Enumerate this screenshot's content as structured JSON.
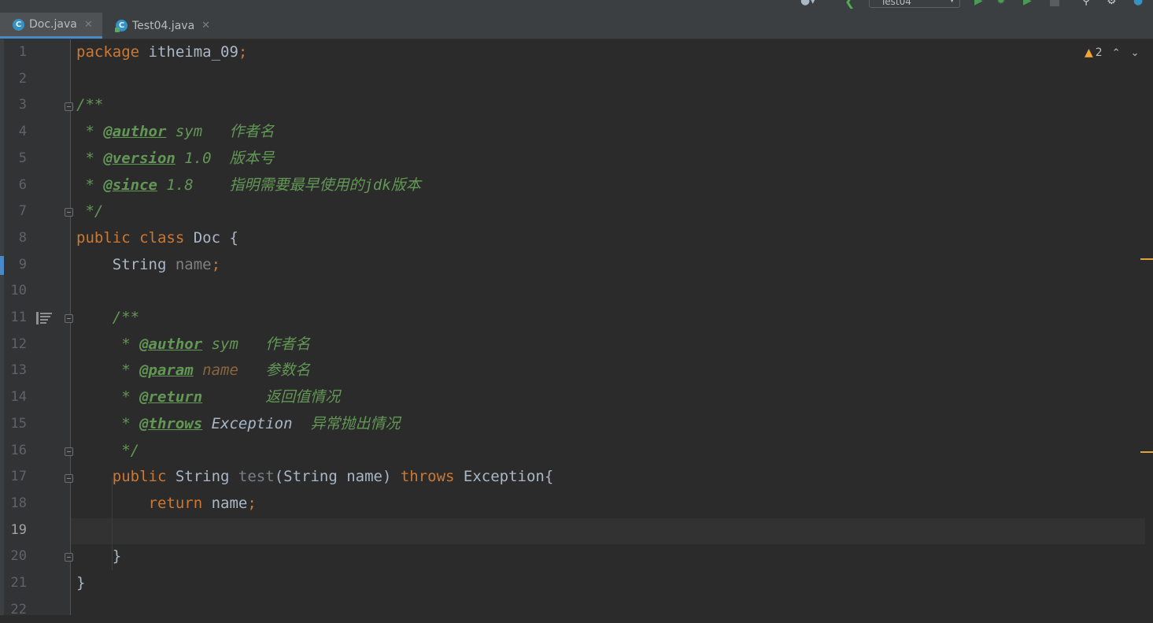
{
  "toolbar": {
    "run_config": "Test04",
    "icons": [
      "user-icon",
      "back-arrow-icon",
      "run-icon",
      "debug-icon",
      "coverage-icon",
      "stop-icon",
      "search-icon",
      "settings-icon",
      "edge-icon"
    ]
  },
  "tabs": [
    {
      "label": "Doc.java",
      "active": true,
      "icon": "class-icon"
    },
    {
      "label": "Test04.java",
      "active": false,
      "icon": "class-runnable-icon"
    }
  ],
  "inspection": {
    "warnings": "2"
  },
  "editor": {
    "line_numbers": [
      "1",
      "2",
      "3",
      "4",
      "5",
      "6",
      "7",
      "8",
      "9",
      "10",
      "11",
      "12",
      "13",
      "14",
      "15",
      "16",
      "17",
      "18",
      "19",
      "20",
      "21",
      "22"
    ],
    "current_line": "19",
    "lines": {
      "l1": {
        "kw": "package",
        "rest": " itheima_09",
        "semi": ";"
      },
      "l3": {
        "text": "/**"
      },
      "l4": {
        "star": " * ",
        "tag": "@author",
        "val": " sym   ",
        "desc": "作者名"
      },
      "l5": {
        "star": " * ",
        "tag": "@version",
        "val": " 1.0  ",
        "desc": "版本号"
      },
      "l6": {
        "star": " * ",
        "tag": "@since",
        "val": " 1.8    ",
        "desc": "指明需要最早使用的jdk版本"
      },
      "l7": {
        "text": " */"
      },
      "l8": {
        "kw1": "public",
        "kw2": " class",
        "rest": " Doc {"
      },
      "l9": {
        "type": "    String ",
        "field": "name",
        "semi": ";"
      },
      "l11": {
        "text": "    /**"
      },
      "l12": {
        "star": "     * ",
        "tag": "@author",
        "val": " sym   ",
        "desc": "作者名"
      },
      "l13": {
        "star": "     * ",
        "tag": "@param",
        "val": " name",
        "gap": "   ",
        "desc": "参数名"
      },
      "l14": {
        "star": "     * ",
        "tag": "@return",
        "gap": "       ",
        "desc": "返回值情况"
      },
      "l15": {
        "star": "     * ",
        "tag": "@throws",
        "val": " Exception",
        "gap": "  ",
        "desc": "异常抛出情况"
      },
      "l16": {
        "text": "     */"
      },
      "l17": {
        "indent": "    ",
        "kw1": "public",
        "type": " String ",
        "name": "test",
        "params": "(String name) ",
        "kw2": "throws",
        "rest": " Exception{"
      },
      "l18": {
        "indent": "        ",
        "kw": "return",
        "rest": " name",
        "semi": ";"
      },
      "l20": {
        "text": "    }"
      },
      "l21": {
        "text": "}"
      }
    }
  }
}
